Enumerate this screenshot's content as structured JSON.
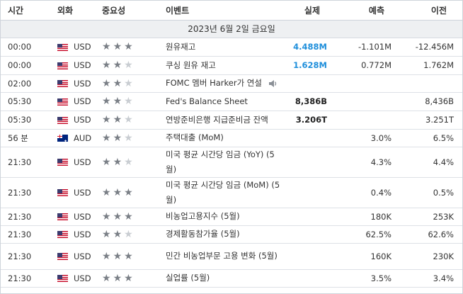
{
  "header": {
    "time": "시간",
    "currency": "외화",
    "importance": "중요성",
    "event": "이벤트",
    "actual": "실제",
    "forecast": "예측",
    "previous": "이전"
  },
  "date_label": "2023년 6월 2일 금요일",
  "colors": {
    "actual_positive": "#1f8fdb",
    "actual_neutral": "#222222",
    "star_on": "#7a7f86",
    "star_off": "#c9cdd2"
  },
  "rows": [
    {
      "time": "00:00",
      "flag": "us-flag-icon",
      "currency": "USD",
      "stars": 3,
      "event": "원유재고",
      "actual": "4.488M",
      "actual_color": "blue",
      "forecast": "-1.101M",
      "previous": "-12.456M"
    },
    {
      "time": "00:00",
      "flag": "us-flag-icon",
      "currency": "USD",
      "stars": 2,
      "event": "쿠싱 원유 재고",
      "actual": "1.628M",
      "actual_color": "blue",
      "forecast": "0.772M",
      "previous": "1.762M"
    },
    {
      "time": "02:00",
      "flag": "us-flag-icon",
      "currency": "USD",
      "stars": 2,
      "event": "FOMC 멤버 Harker가 연설",
      "speaker": true,
      "actual": "",
      "forecast": "",
      "previous": ""
    },
    {
      "time": "05:30",
      "flag": "us-flag-icon",
      "currency": "USD",
      "stars": 2,
      "event": "Fed's Balance Sheet",
      "actual": "8,386B",
      "actual_color": "black",
      "forecast": "",
      "previous": "8,436B"
    },
    {
      "time": "05:30",
      "flag": "us-flag-icon",
      "currency": "USD",
      "stars": 2,
      "event": "연방준비은행 지급준비금 잔액",
      "actual": "3.206T",
      "actual_color": "black",
      "forecast": "",
      "previous": "3.251T"
    },
    {
      "time": "56 분",
      "flag": "au-flag-icon",
      "currency": "AUD",
      "stars": 2,
      "event": "주택대출 (MoM)",
      "actual": "",
      "forecast": "3.0%",
      "previous": "6.5%"
    },
    {
      "time": "21:30",
      "flag": "us-flag-icon",
      "currency": "USD",
      "stars": 2,
      "event": "미국 평균 시간당 임금 (YoY) (5월)",
      "actual": "",
      "forecast": "4.3%",
      "previous": "4.4%"
    },
    {
      "time": "21:30",
      "flag": "us-flag-icon",
      "currency": "USD",
      "stars": 3,
      "event": "미국 평균 시간당 임금 (MoM) (5월)",
      "actual": "",
      "forecast": "0.4%",
      "previous": "0.5%"
    },
    {
      "time": "21:30",
      "flag": "us-flag-icon",
      "currency": "USD",
      "stars": 3,
      "event": "비농업고용지수 (5월)",
      "actual": "",
      "forecast": "180K",
      "previous": "253K"
    },
    {
      "time": "21:30",
      "flag": "us-flag-icon",
      "currency": "USD",
      "stars": 2,
      "event": "경제활동참가율 (5월)",
      "actual": "",
      "forecast": "62.5%",
      "previous": "62.6%"
    },
    {
      "time": "21:30",
      "flag": "us-flag-icon",
      "currency": "USD",
      "stars": 3,
      "event": "민간 비농업부문 고용 변화 (5월)",
      "actual": "",
      "forecast": "160K",
      "previous": "230K"
    },
    {
      "time": "21:30",
      "flag": "us-flag-icon",
      "currency": "USD",
      "stars": 3,
      "event": "실업률 (5월)",
      "actual": "",
      "forecast": "3.5%",
      "previous": "3.4%"
    }
  ]
}
